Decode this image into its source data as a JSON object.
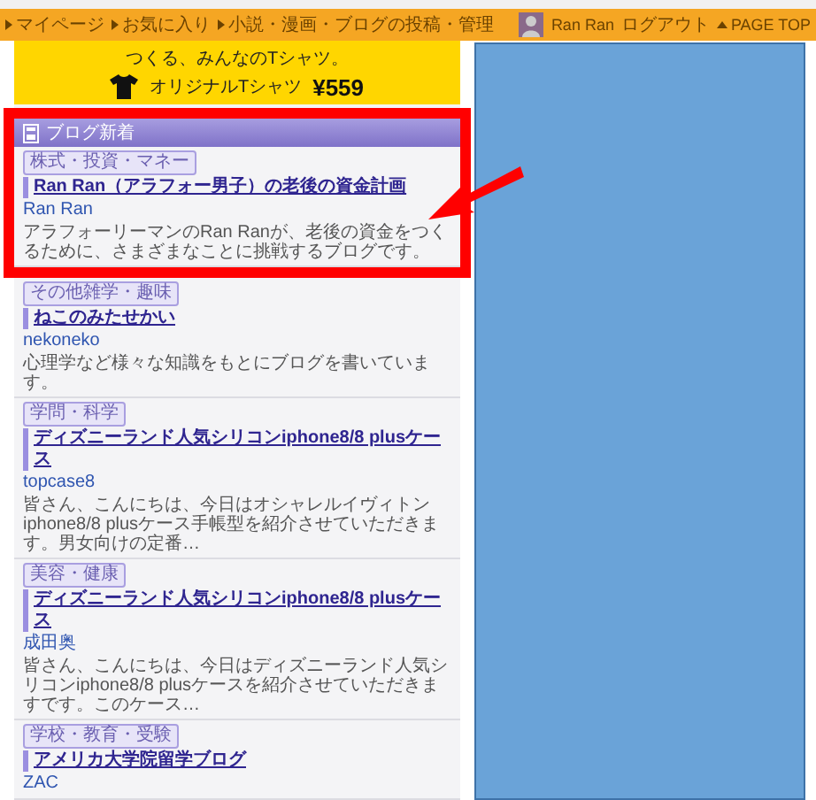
{
  "top_bar": {
    "links": [
      {
        "label": "マイページ"
      },
      {
        "label": "お気に入り"
      },
      {
        "label": "小説・漫画・ブログの投稿・管理"
      }
    ],
    "user_name": "Ran Ran",
    "logout": "ログアウト",
    "page_top": "PAGE TOP"
  },
  "ad_banner": {
    "tagline": "つくる、みんなのTシャツ。",
    "product": "オリジナルTシャツ",
    "price": "¥559"
  },
  "widget": {
    "title": "ブログ新着",
    "highlight_first": true,
    "pointer_arrow": true,
    "posts": [
      {
        "category": "株式・投資・マネー",
        "title": "Ran Ran（アラフォー男子）の老後の資金計画",
        "author": "Ran Ran",
        "description": "アラフォーリーマンのRan Ranが、老後の資金をつくるために、さまざまなことに挑戦するブログです。"
      },
      {
        "category": "その他雑学・趣味",
        "title": "ねこのみたせかい",
        "author": "nekoneko",
        "description": "心理学など様々な知識をもとにブログを書いています。"
      },
      {
        "category": "学問・科学",
        "title": "ディズニーランド人気シリコンiphone8/8 plusケース",
        "author": "topcase8",
        "description": "皆さん、こんにちは、今日はオシャレルイヴィトンiphone8/8 plusケース手帳型を紹介させていただきます。男女向けの定番…"
      },
      {
        "category": "美容・健康",
        "title": "ディズニーランド人気シリコンiphone8/8 plusケース",
        "author": "成田奥",
        "description": "皆さん、こんにちは、今日はディズニーランド人気シリコンiphone8/8 plusケースを紹介させていただきますです。このケース…"
      },
      {
        "category": "学校・教育・受験",
        "title": "アメリカ大学院留学ブログ",
        "author": "ZAC"
      }
    ]
  }
}
